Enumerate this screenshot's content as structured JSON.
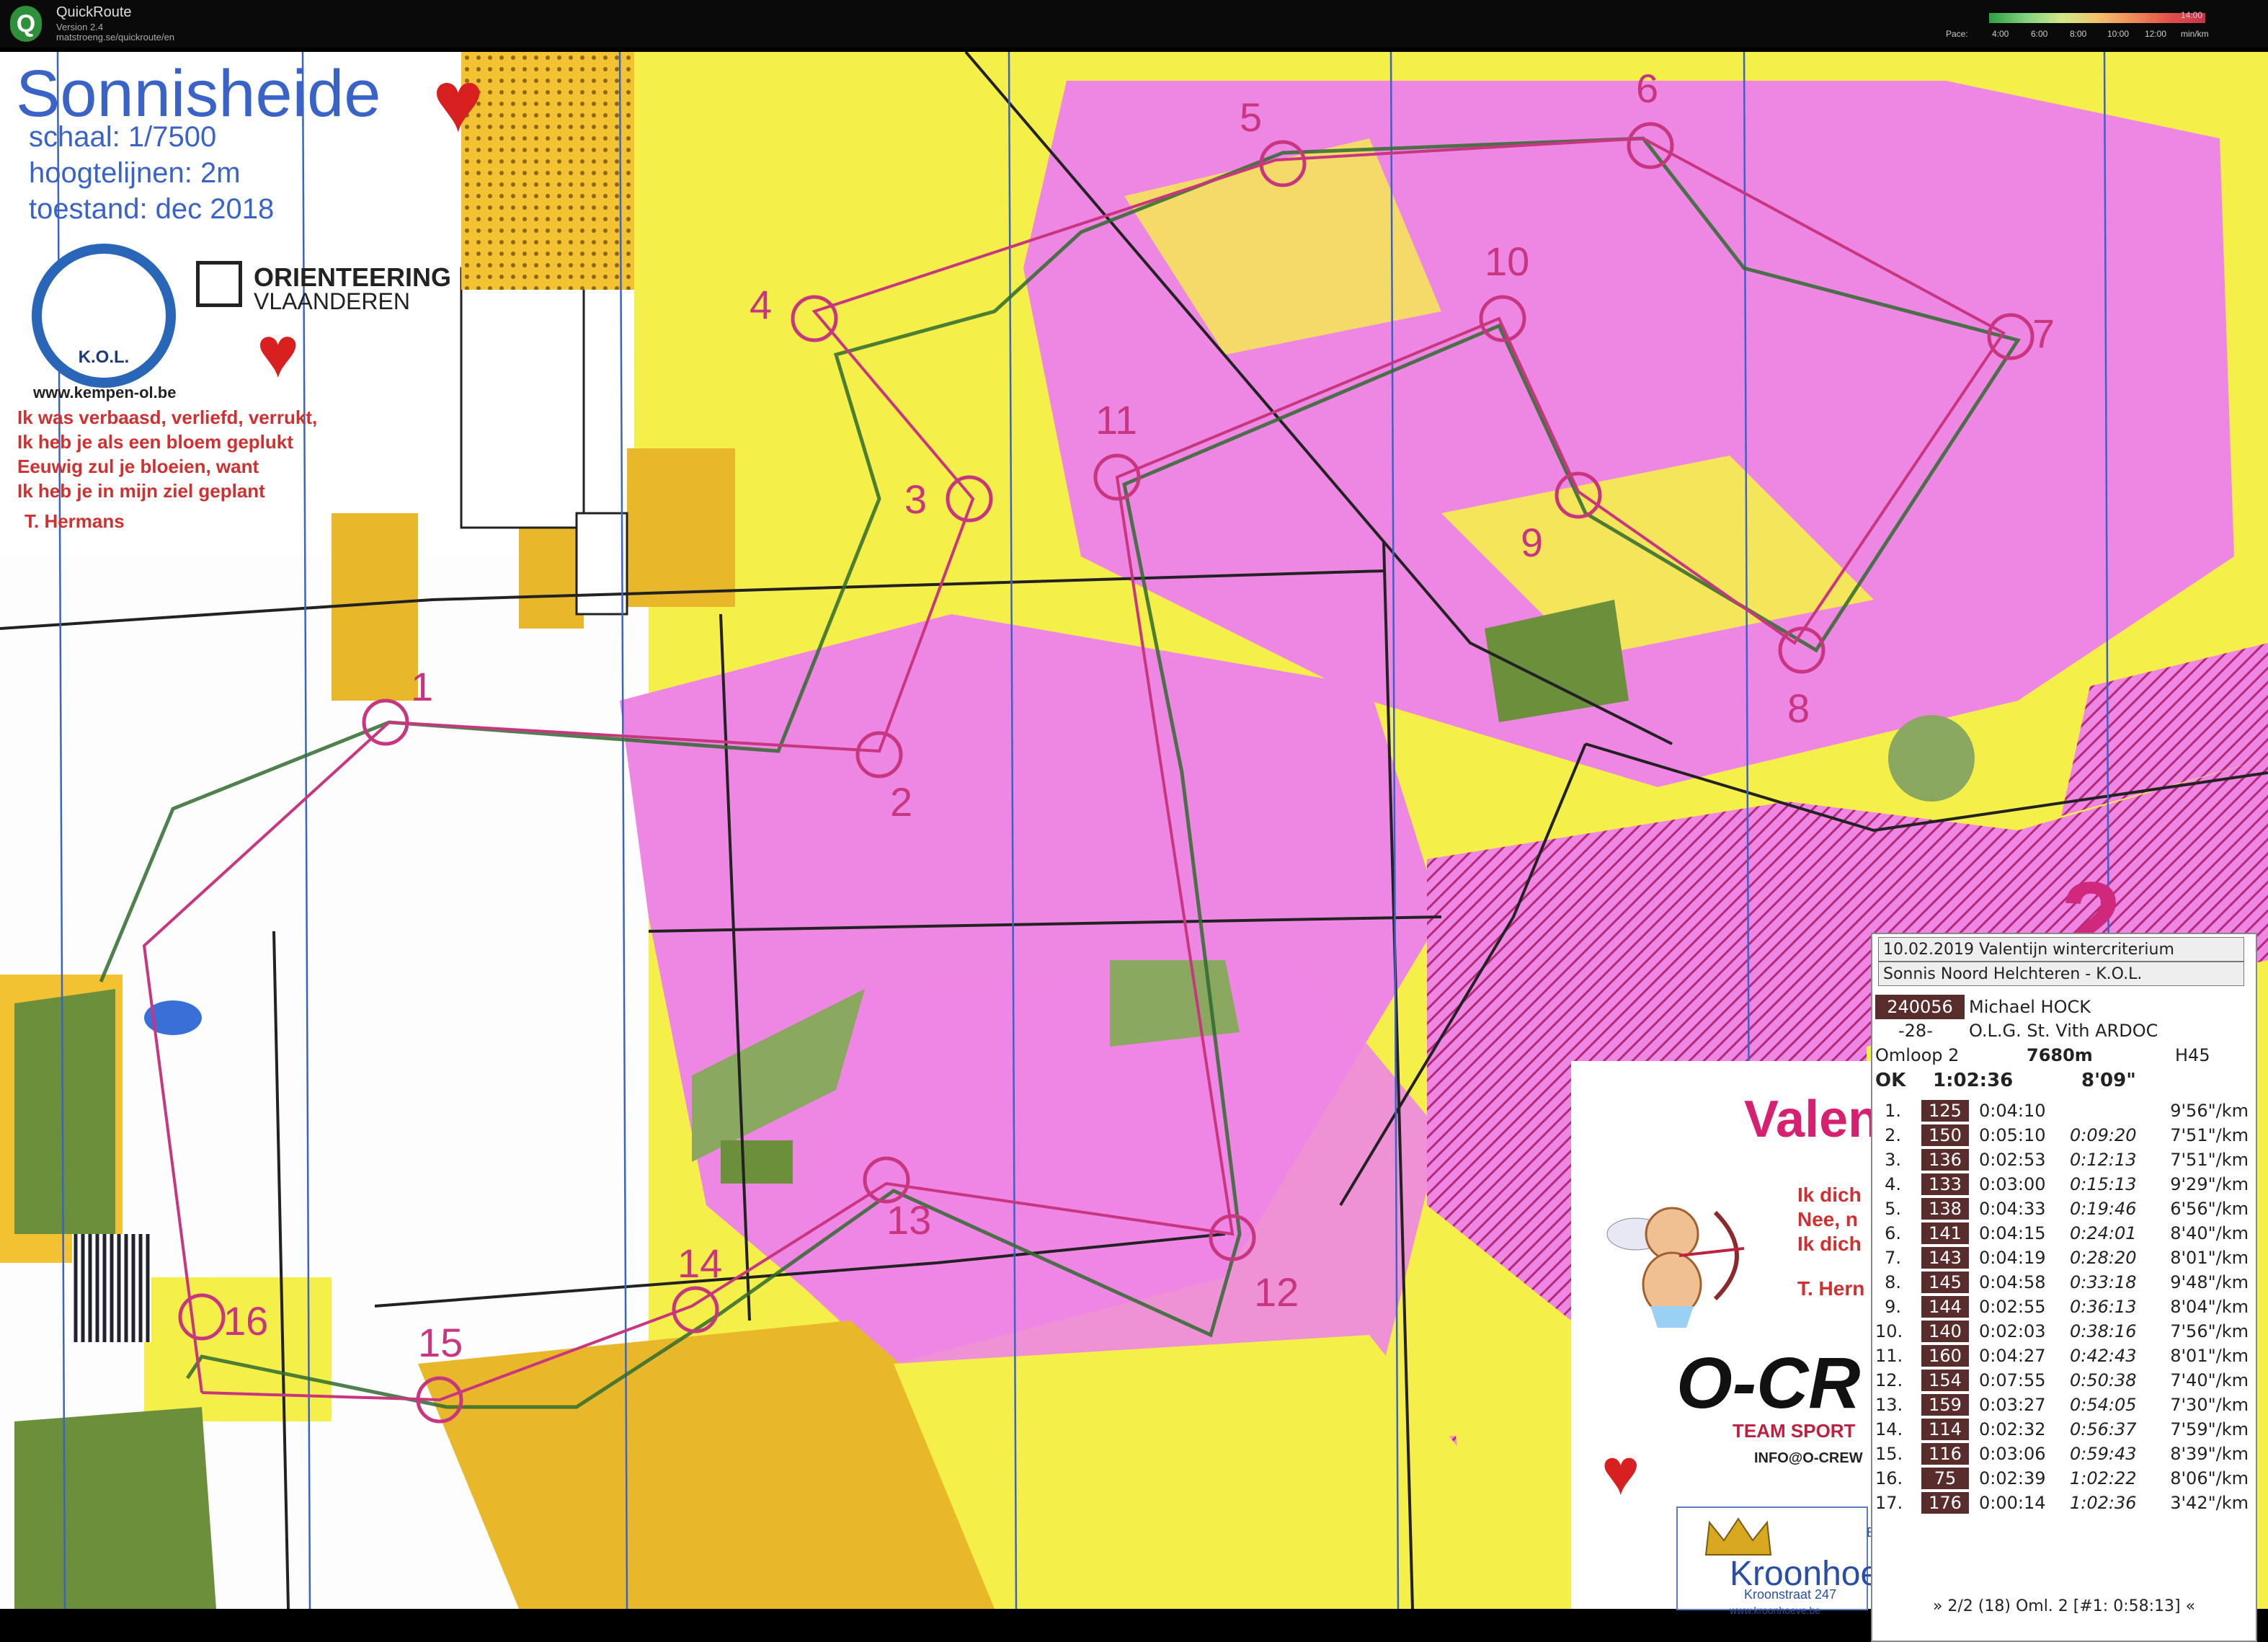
{
  "app": {
    "title": "QuickRoute",
    "version": "Version 2.4",
    "url": "matstroeng.se/quickroute/en"
  },
  "pace_legend": {
    "label": "Pace:",
    "ticks": [
      "4:00",
      "6:00",
      "8:00",
      "10:00",
      "12:00",
      "14:00"
    ],
    "unit": "min/km"
  },
  "map": {
    "title": "Sonnisheide",
    "scale": "schaal: 1/7500",
    "contours": "hoogtelijnen: 2m",
    "state": "toestand: dec 2018",
    "club_logo_text": "K.O.L.",
    "federation_line1": "ORIENTEERING",
    "federation_line2": "VLAANDEREN",
    "website": "www.kempen-ol.be",
    "poem": [
      "Ik was verbaasd, verliefd, verrukt,",
      "Ik heb je als een bloem geplukt",
      "Eeuwig zul je bloeien, want",
      "Ik heb je in mijn ziel geplant"
    ],
    "poem_author": "T. Hermans",
    "big_number": "2",
    "colors": {
      "rough_open": "#f5ef4a",
      "open_land": "#f2c233",
      "vegetation_pink": "#ee86e4",
      "forbidden": "#c0307a",
      "course": "#c8367f",
      "route": "#2f6b2f",
      "water_lines": "#3a63c8"
    }
  },
  "controls": [
    {
      "num": "1"
    },
    {
      "num": "2"
    },
    {
      "num": "3"
    },
    {
      "num": "4"
    },
    {
      "num": "5"
    },
    {
      "num": "6"
    },
    {
      "num": "7"
    },
    {
      "num": "8"
    },
    {
      "num": "9"
    },
    {
      "num": "10"
    },
    {
      "num": "11"
    },
    {
      "num": "12"
    },
    {
      "num": "13"
    },
    {
      "num": "14"
    },
    {
      "num": "15"
    },
    {
      "num": "16"
    }
  ],
  "sponsor": {
    "title": "Valen",
    "lines": [
      "Ik dich",
      "Nee, n",
      "Ik dich"
    ],
    "author": "T. Hern",
    "brand": "O-CR",
    "brand_sub": "TEAM SPORT",
    "email": "INFO@O-CREW",
    "hotel": "Kroonhoe",
    "hotel_bed": "Bed",
    "hotel_addr": "Kroonstraat 247",
    "hotel_web": "www.kroonhoeve.be"
  },
  "splits": {
    "header1": "10.02.2019  Valentijn wintercriterium",
    "header2": "Sonnis Noord Helchteren - K.O.L.",
    "runner_id": "240056",
    "runner_name": "Michael HOCK",
    "category": "-28-",
    "club": "O.L.G. St. Vith ARDOC",
    "course": "Omloop  2",
    "length": "7680m",
    "class": "H45",
    "status": "OK",
    "total_time": "1:02:36",
    "avg_pace": "8'09\"",
    "rows": [
      {
        "n": "1.",
        "code": "125",
        "leg": "0:04:10",
        "cum": "",
        "pace": "9'56\"/km"
      },
      {
        "n": "2.",
        "code": "150",
        "leg": "0:05:10",
        "cum": "0:09:20",
        "pace": "7'51\"/km"
      },
      {
        "n": "3.",
        "code": "136",
        "leg": "0:02:53",
        "cum": "0:12:13",
        "pace": "7'51\"/km"
      },
      {
        "n": "4.",
        "code": "133",
        "leg": "0:03:00",
        "cum": "0:15:13",
        "pace": "9'29\"/km"
      },
      {
        "n": "5.",
        "code": "138",
        "leg": "0:04:33",
        "cum": "0:19:46",
        "pace": "6'56\"/km"
      },
      {
        "n": "6.",
        "code": "141",
        "leg": "0:04:15",
        "cum": "0:24:01",
        "pace": "8'40\"/km"
      },
      {
        "n": "7.",
        "code": "143",
        "leg": "0:04:19",
        "cum": "0:28:20",
        "pace": "8'01\"/km"
      },
      {
        "n": "8.",
        "code": "145",
        "leg": "0:04:58",
        "cum": "0:33:18",
        "pace": "9'48\"/km"
      },
      {
        "n": "9.",
        "code": "144",
        "leg": "0:02:55",
        "cum": "0:36:13",
        "pace": "8'04\"/km"
      },
      {
        "n": "10.",
        "code": "140",
        "leg": "0:02:03",
        "cum": "0:38:16",
        "pace": "7'56\"/km"
      },
      {
        "n": "11.",
        "code": "160",
        "leg": "0:04:27",
        "cum": "0:42:43",
        "pace": "8'01\"/km"
      },
      {
        "n": "12.",
        "code": "154",
        "leg": "0:07:55",
        "cum": "0:50:38",
        "pace": "7'40\"/km"
      },
      {
        "n": "13.",
        "code": "159",
        "leg": "0:03:27",
        "cum": "0:54:05",
        "pace": "7'30\"/km"
      },
      {
        "n": "14.",
        "code": "114",
        "leg": "0:02:32",
        "cum": "0:56:37",
        "pace": "7'59\"/km"
      },
      {
        "n": "15.",
        "code": "116",
        "leg": "0:03:06",
        "cum": "0:59:43",
        "pace": "8'39\"/km"
      },
      {
        "n": "16.",
        "code": "75",
        "leg": "0:02:39",
        "cum": "1:02:22",
        "pace": "8'06\"/km"
      },
      {
        "n": "17.",
        "code": "176",
        "leg": "0:00:14",
        "cum": "1:02:36",
        "pace": "3'42\"/km"
      }
    ],
    "footer": "» 2/2 (18) Oml. 2 [#1: 0:58:13] «"
  }
}
